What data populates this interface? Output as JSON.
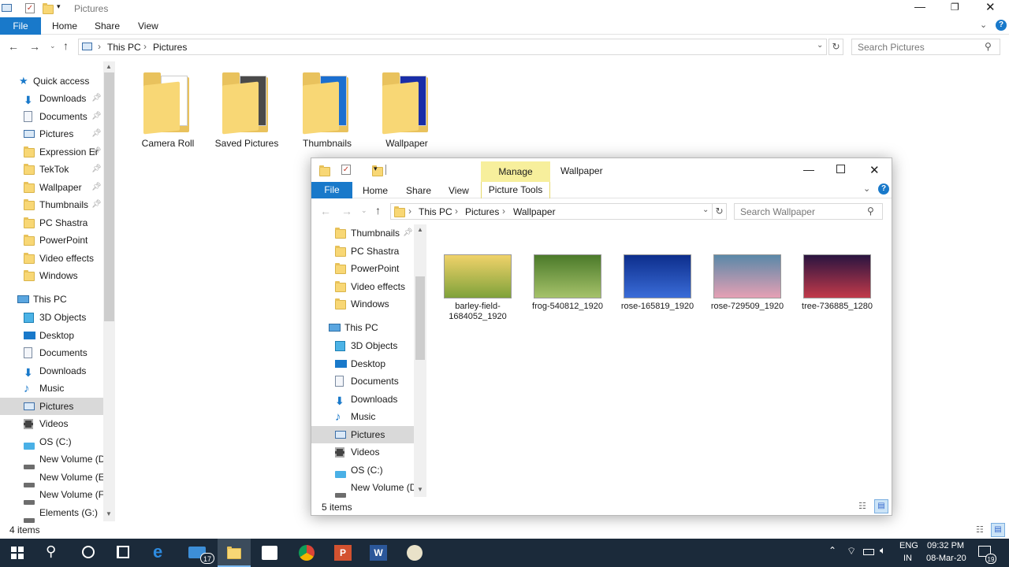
{
  "bg_window": {
    "title": "Pictures",
    "ribbon_tabs": [
      "File",
      "Home",
      "Share",
      "View"
    ],
    "breadcrumb": [
      "This PC",
      "Pictures"
    ],
    "search_placeholder": "Search Pictures",
    "status": "4 items",
    "folders": [
      "Camera Roll",
      "Saved Pictures",
      "Thumbnails",
      "Wallpaper"
    ],
    "quick_access_label": "Quick access",
    "quick_access": [
      "Downloads",
      "Documents",
      "Pictures",
      "Expression Er",
      "TekTok",
      "Wallpaper",
      "Thumbnails",
      "PC Shastra",
      "PowerPoint",
      "Video effects",
      "Windows"
    ],
    "this_pc_label": "This PC",
    "this_pc": [
      "3D Objects",
      "Desktop",
      "Documents",
      "Downloads",
      "Music",
      "Pictures",
      "Videos",
      "OS (C:)",
      "New Volume (D:",
      "New Volume (E:)",
      "New Volume (F:)",
      "Elements (G:)"
    ]
  },
  "fg_window": {
    "title": "Wallpaper",
    "manage_label": "Manage",
    "picture_tools_label": "Picture Tools",
    "ribbon_tabs": [
      "File",
      "Home",
      "Share",
      "View"
    ],
    "breadcrumb": [
      "This PC",
      "Pictures",
      "Wallpaper"
    ],
    "search_placeholder": "Search Wallpaper",
    "status": "5 items",
    "nav_quick": [
      "Thumbnails",
      "PC Shastra",
      "PowerPoint",
      "Video effects",
      "Windows"
    ],
    "this_pc_label": "This PC",
    "nav_pc": [
      "3D Objects",
      "Desktop",
      "Documents",
      "Downloads",
      "Music",
      "Pictures",
      "Videos",
      "OS (C:)",
      "New Volume (D:"
    ],
    "files": [
      {
        "name": "barley-field-1684052_1920",
        "colors": [
          "#f0d26a",
          "#7fa23a"
        ]
      },
      {
        "name": "frog-540812_1920",
        "colors": [
          "#4b7a2a",
          "#a6c26a"
        ]
      },
      {
        "name": "rose-165819_1920",
        "colors": [
          "#0d2e8c",
          "#3a6cd8"
        ]
      },
      {
        "name": "rose-729509_1920",
        "colors": [
          "#5a88a8",
          "#e6a0b4"
        ]
      },
      {
        "name": "tree-736885_1280",
        "colors": [
          "#2a1440",
          "#c23a4a"
        ]
      }
    ]
  },
  "taskbar": {
    "lang": "ENG",
    "region": "IN",
    "time": "09:32 PM",
    "date": "08-Mar-20",
    "mail_badge": "17",
    "notif_badge": "19"
  },
  "colors": {
    "accent": "#1979ca",
    "manage_bg": "#f7ef9c",
    "taskbar": "#1b2a3a",
    "selected": "#cce4f7"
  }
}
